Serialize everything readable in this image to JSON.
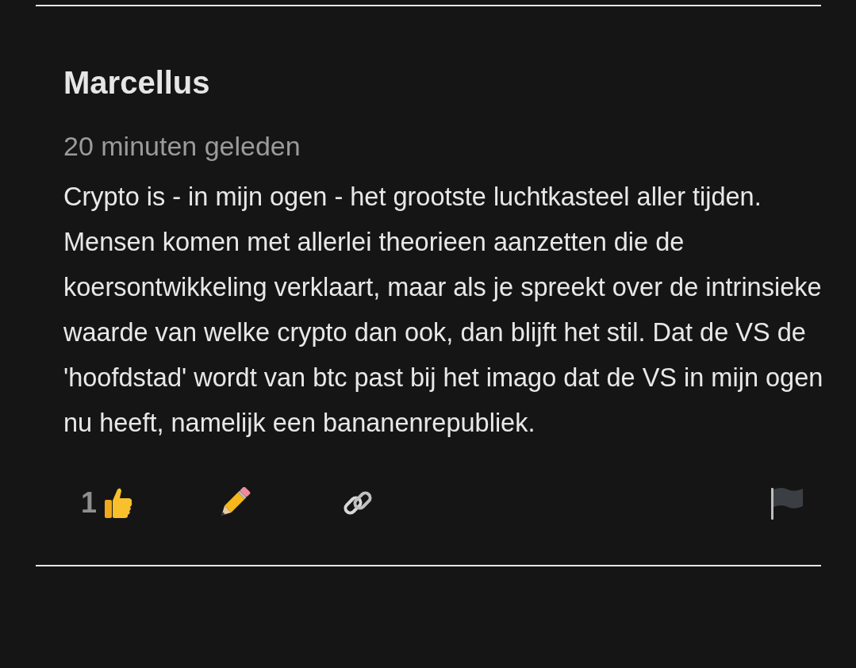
{
  "comment": {
    "author": "Marcellus",
    "time": "20 minuten geleden",
    "body": "Crypto is - in mijn ogen - het grootste luchtkasteel aller tijden. Mensen komen met allerlei theorieen aanzetten die de koersontwikkeling verklaart, maar als je spreekt over de intrinsieke waarde van welke crypto dan ook, dan blijft het stil. Dat de VS de 'hoofdstad' wordt van btc past bij het imago dat de VS in mijn ogen nu heeft, namelijk een bananenrepubliek.",
    "likes": "1"
  }
}
